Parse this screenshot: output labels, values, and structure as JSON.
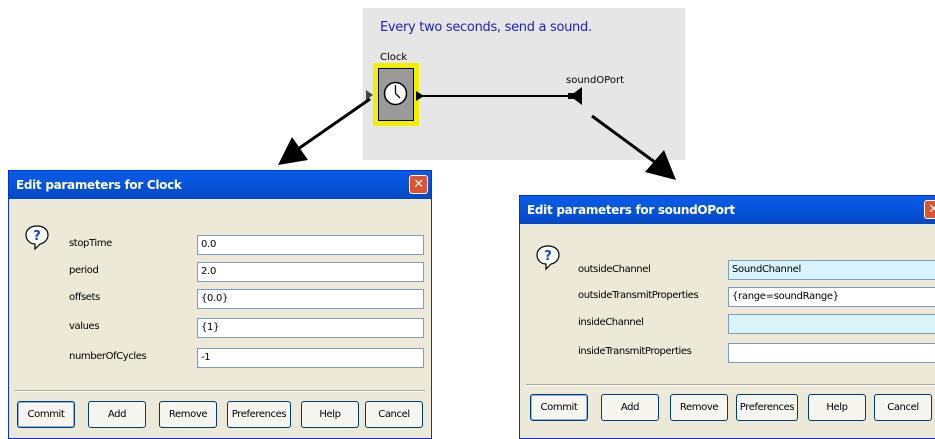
{
  "diagram": {
    "caption": "Every two seconds, send a sound.",
    "clock_label": "Clock",
    "port_label": "soundOPort"
  },
  "clock_dialog": {
    "title": "Edit parameters for Clock",
    "params": [
      {
        "label": "stopTime",
        "value": "0.0"
      },
      {
        "label": "period",
        "value": "2.0"
      },
      {
        "label": "offsets",
        "value": "{0.0}"
      },
      {
        "label": "values",
        "value": "{1}"
      },
      {
        "label": "numberOfCycles",
        "value": "-1"
      }
    ],
    "buttons": [
      "Commit",
      "Add",
      "Remove",
      "Preferences",
      "Help",
      "Cancel"
    ]
  },
  "port_dialog": {
    "title": "Edit parameters for soundOPort",
    "params": [
      {
        "label": "outsideChannel",
        "value": "SoundChannel"
      },
      {
        "label": "outsideTransmitProperties",
        "value": "{range=soundRange}"
      },
      {
        "label": "insideChannel",
        "value": ""
      },
      {
        "label": "insideTransmitProperties",
        "value": ""
      }
    ],
    "buttons": [
      "Commit",
      "Add",
      "Remove",
      "Preferences",
      "Help",
      "Cancel"
    ]
  },
  "colors": {
    "titlebar": "#0655dd",
    "dialog_bg": "#ece9d8",
    "highlight": "#f3ef00",
    "caption_text": "#2222bb",
    "close_button": "#e0512e"
  },
  "icons": {
    "dialog_icon": "question-icon",
    "clock_icon": "clock-icon",
    "close_icon": "close-icon"
  }
}
